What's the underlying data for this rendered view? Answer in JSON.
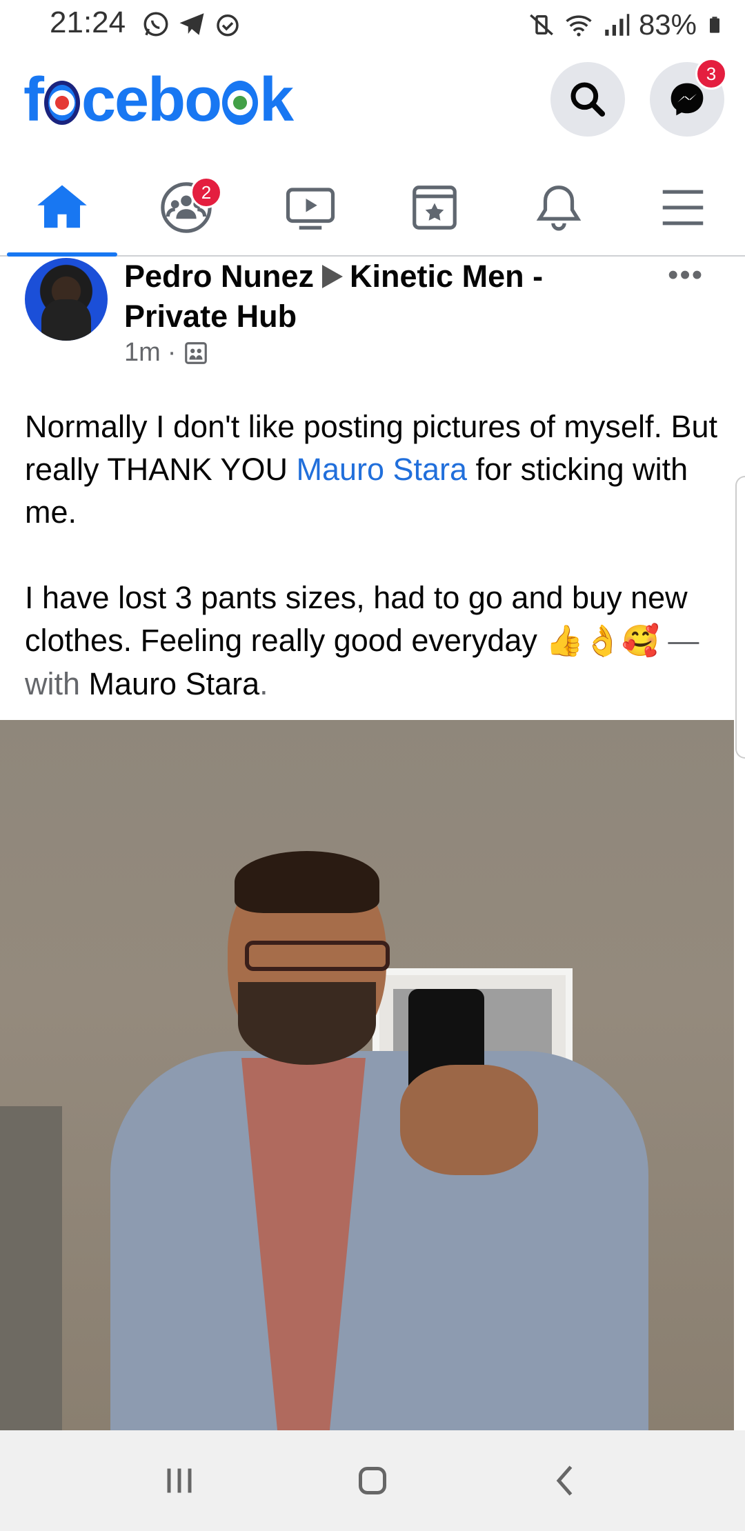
{
  "status_bar": {
    "time": "21:24",
    "battery": "83%"
  },
  "header": {
    "logo_parts": [
      "f",
      "cebo",
      "k"
    ],
    "messenger_badge": "3"
  },
  "tabs": [
    {
      "name": "home",
      "icon": "home-icon",
      "active": true
    },
    {
      "name": "groups",
      "icon": "groups-icon",
      "badge": "2"
    },
    {
      "name": "watch",
      "icon": "video-icon"
    },
    {
      "name": "saved",
      "icon": "bookmark-star-icon"
    },
    {
      "name": "notifications",
      "icon": "bell-icon"
    },
    {
      "name": "menu",
      "icon": "hamburger-icon"
    }
  ],
  "post": {
    "author": "Pedro Nunez",
    "group": "Kinetic Men - Private Hub",
    "time": "1m",
    "more": "•••",
    "text_p1_a": "Normally I don't like posting pictures of myself. But really THANK YOU ",
    "text_p1_link": "Mauro Stara",
    "text_p1_b": " for sticking with me.",
    "text_p2": "I have lost 3 pants sizes, had to go and buy new clothes. Feeling really good everyday ",
    "emoji_1": "👍",
    "emoji_2": "👌",
    "emoji_3": "🥰",
    "with_prefix": " — with ",
    "with_name": "Mauro Stara",
    "with_suffix": "."
  }
}
